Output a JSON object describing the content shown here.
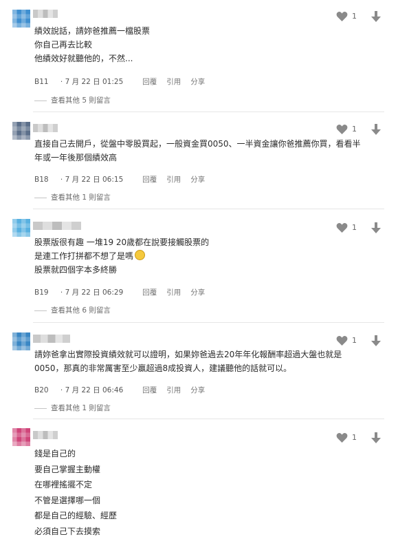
{
  "colors": {
    "avatar_1": "#3f8fd0",
    "avatar_2": "#5b6f8a",
    "avatar_3": "#58b0e0",
    "avatar_4": "#3a87c4",
    "avatar_5": "#d0457a",
    "icon_gray": "#8a8a8a"
  },
  "comments": [
    {
      "lines": [
        "績效說話，請妳爸推薦一檔股票",
        "你自己再去比較",
        "他績效好就聽他的，不然..."
      ],
      "floor": "B11",
      "date": "7 月 22 日 01:25",
      "reply": "回覆",
      "quote": "引用",
      "share": "分享",
      "likes": "1",
      "view_replies": "查看其他 5 則留言"
    },
    {
      "lines": [
        "直接自己去開戶，從盤中零股買起，一般資金買0050、一半資金讓你爸推薦你買，看看半",
        "年或一年後那個績效高"
      ],
      "floor": "B18",
      "date": "7 月 22 日 06:15",
      "reply": "回覆",
      "quote": "引用",
      "share": "分享",
      "likes": "1",
      "view_replies": "查看其他 1 則留言"
    },
    {
      "lines": [
        "股票版很有趣 一堆19 20歲都在說要接觸股票的",
        "是連工作打拼都不想了是嗎",
        "股票就四個字本多終勝"
      ],
      "floor": "B19",
      "date": "7 月 22 日 06:29",
      "reply": "回覆",
      "quote": "引用",
      "share": "分享",
      "likes": "1",
      "view_replies": "查看其他 6 則留言"
    },
    {
      "lines": [
        "請妳爸拿出實際投資績效就可以證明，如果妳爸過去20年年化報酬率超過大盤也就是",
        "0050，那真的非常厲害至少贏超過8成投資人，建議聽他的話就可以。"
      ],
      "floor": "B20",
      "date": "7 月 22 日 06:46",
      "reply": "回覆",
      "quote": "引用",
      "share": "分享",
      "likes": "1",
      "view_replies": "查看其他 1 則留言"
    },
    {
      "lines": [
        "錢是自己的",
        "要自己掌握主動權",
        "在哪裡搖擺不定",
        "不管是選擇哪一個",
        "都是自己的經驗、經歷",
        "必須自己下去摸索"
      ],
      "likes": "1"
    }
  ]
}
